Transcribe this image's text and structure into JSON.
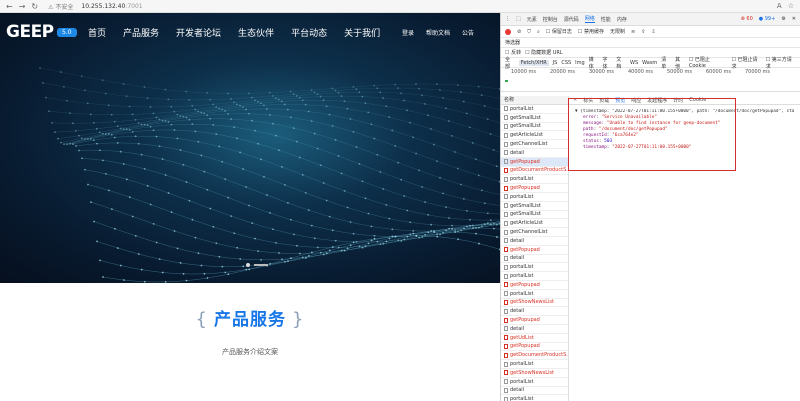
{
  "browser": {
    "security_label": "不安全",
    "url_host": "10.255.132.40",
    "url_port": ":7001",
    "zoom_badge": "A",
    "star": "☆"
  },
  "site": {
    "logo": "GEEP",
    "logo_badge": "5.0",
    "nav": [
      "首页",
      "产品服务",
      "开发者论坛",
      "生态伙伴",
      "平台动态",
      "关于我们"
    ],
    "nav_right": [
      "登录",
      "帮助文档",
      "公告"
    ],
    "section_title": "产品服务",
    "section_subtitle": "产品服务介绍文案"
  },
  "devtools": {
    "tabs": [
      "元素",
      "控制台",
      "源代码",
      "网络",
      "性能",
      "内存"
    ],
    "active_tab": "网络",
    "errors": "60",
    "warnings": "99+",
    "toolbar": [
      "保留日志",
      "禁用缓存",
      "无限制"
    ],
    "filter_label": "筛选器",
    "filter_options": [
      "反转",
      "隐藏数据 URL"
    ],
    "types": [
      "全部",
      "Fetch/XHR",
      "JS",
      "CSS",
      "Img",
      "媒体",
      "字体",
      "文档",
      "WS",
      "Wasm",
      "清单",
      "其他"
    ],
    "type_extras": [
      "已阻止 Cookie",
      "已阻止请求",
      "第三方请求"
    ],
    "timeline_ticks": [
      "10000 ms",
      "20000 ms",
      "30000 ms",
      "40000 ms",
      "50000 ms",
      "60000 ms",
      "70000 ms"
    ],
    "list_header": "名称",
    "requests": [
      {
        "name": "portalList",
        "status": "ok"
      },
      {
        "name": "getSmallList",
        "status": "ok"
      },
      {
        "name": "getSmallList",
        "status": "ok"
      },
      {
        "name": "getArticleList",
        "status": "ok"
      },
      {
        "name": "getChannelList",
        "status": "ok"
      },
      {
        "name": "detail",
        "status": "ok"
      },
      {
        "name": "getPopupad",
        "status": "selected"
      },
      {
        "name": "getDocumentProductS...",
        "status": "err"
      },
      {
        "name": "portalList",
        "status": "ok"
      },
      {
        "name": "getPopupad",
        "status": "err"
      },
      {
        "name": "portalList",
        "status": "ok"
      },
      {
        "name": "getSmallList",
        "status": "ok"
      },
      {
        "name": "getSmallList",
        "status": "ok"
      },
      {
        "name": "getArticleList",
        "status": "ok"
      },
      {
        "name": "getChannelList",
        "status": "ok"
      },
      {
        "name": "detail",
        "status": "ok"
      },
      {
        "name": "getPopupad",
        "status": "err"
      },
      {
        "name": "detail",
        "status": "ok"
      },
      {
        "name": "portalList",
        "status": "ok"
      },
      {
        "name": "portalList",
        "status": "ok"
      },
      {
        "name": "getPopupad",
        "status": "err"
      },
      {
        "name": "portalList",
        "status": "ok"
      },
      {
        "name": "getShowNewsList",
        "status": "err"
      },
      {
        "name": "detail",
        "status": "ok"
      },
      {
        "name": "getPopupad",
        "status": "err"
      },
      {
        "name": "detail",
        "status": "ok"
      },
      {
        "name": "getUdList",
        "status": "err"
      },
      {
        "name": "getPopupad",
        "status": "err"
      },
      {
        "name": "getDocumentProductS...",
        "status": "err"
      },
      {
        "name": "portalList",
        "status": "ok"
      },
      {
        "name": "getShowNewsList",
        "status": "err"
      },
      {
        "name": "portalList",
        "status": "ok"
      },
      {
        "name": "detail",
        "status": "ok"
      },
      {
        "name": "portalList",
        "status": "ok"
      }
    ],
    "detail_tabs": [
      "标头",
      "负载",
      "预览",
      "响应",
      "发起程序",
      "计时",
      "Cookie"
    ],
    "active_detail_tab": "预览",
    "response": {
      "summary": "{timestamp: \"2022-07-27T01:11:00.155+0000\", path: \"/document/doc/getPopupad\", sta",
      "lines": [
        {
          "key": "error",
          "value": "\"Service Unavailable\"",
          "kind": "s"
        },
        {
          "key": "message",
          "value": "\"Unable to find instance for geep-document\"",
          "kind": "s"
        },
        {
          "key": "path",
          "value": "\"/document/doc/getPopupad\"",
          "kind": "s"
        },
        {
          "key": "requestId",
          "value": "\"6ca764e2\"",
          "kind": "s"
        },
        {
          "key": "status",
          "value": "503",
          "kind": "n"
        },
        {
          "key": "timestamp",
          "value": "\"2022-07-27T01:11:00.155+0000\"",
          "kind": "s"
        }
      ]
    }
  }
}
